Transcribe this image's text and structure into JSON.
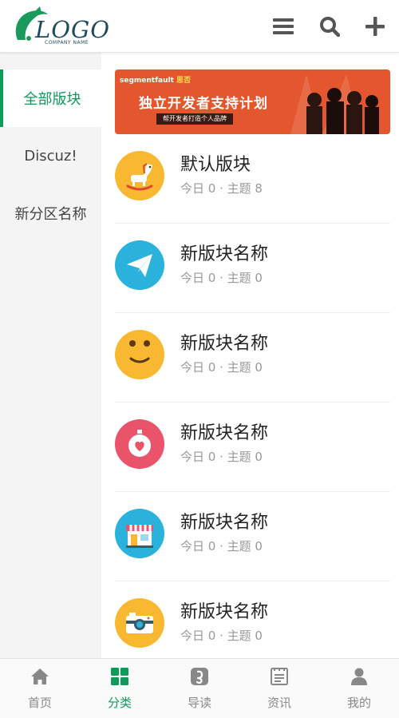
{
  "header": {
    "logo_text": "LOGO",
    "logo_subtext": "COMPANY NAME",
    "menu_icon": "menu-icon",
    "search_icon": "search-icon",
    "add_icon": "plus-icon"
  },
  "sidebar": {
    "items": [
      {
        "label": "全部版块",
        "active": true
      },
      {
        "label": "Discuz!",
        "active": false
      },
      {
        "label": "新分区名称",
        "active": false
      }
    ]
  },
  "banner": {
    "brand": "segmentfault",
    "brand_suffix": "思否",
    "title": "独立开发者支持计划",
    "subtitle": "帮开发者打造个人品牌"
  },
  "forums": [
    {
      "name": "默认版块",
      "stats": "今日 0 · 主题 8",
      "icon": "rocking-horse-icon",
      "color": "#f9b832"
    },
    {
      "name": "新版块名称",
      "stats": "今日 0 · 主题 0",
      "icon": "paper-plane-icon",
      "color": "#2ab2dc"
    },
    {
      "name": "新版块名称",
      "stats": "今日 0 · 主题 0",
      "icon": "smiley-icon",
      "color": "#f9b832"
    },
    {
      "name": "新版块名称",
      "stats": "今日 0 · 主题 0",
      "icon": "stopwatch-heart-icon",
      "color": "#e9546b"
    },
    {
      "name": "新版块名称",
      "stats": "今日 0 · 主题 0",
      "icon": "shop-icon",
      "color": "#2ab2dc"
    },
    {
      "name": "新版块名称",
      "stats": "今日 0 · 主题 0",
      "icon": "camera-icon",
      "color": "#f9b832"
    }
  ],
  "tabbar": {
    "tabs": [
      {
        "label": "首页",
        "icon": "home-icon",
        "active": false
      },
      {
        "label": "分类",
        "icon": "grid-icon",
        "active": true
      },
      {
        "label": "导读",
        "icon": "guide-icon",
        "active": false
      },
      {
        "label": "资讯",
        "icon": "news-icon",
        "active": false
      },
      {
        "label": "我的",
        "icon": "user-icon",
        "active": false
      }
    ]
  },
  "colors": {
    "accent": "#0f9a5a",
    "sidebar_bg": "#f4f4f4",
    "banner_bg": "#e4572e"
  }
}
